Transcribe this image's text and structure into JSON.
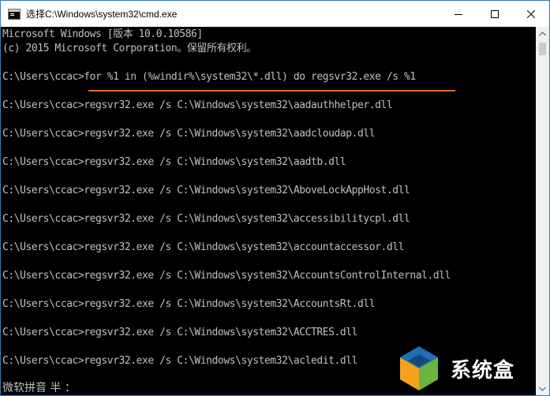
{
  "window": {
    "title": "选择C:\\Windows\\system32\\cmd.exe",
    "controls": {
      "minimize": "minimize-icon",
      "maximize": "maximize-icon",
      "close": "close-icon"
    }
  },
  "console": {
    "header_1": "Microsoft Windows [版本 10.0.10586]",
    "header_2": "(c) 2015 Microsoft Corporation。保留所有权利。",
    "prompt": "C:\\Users\\ccac>",
    "command": "for %1 in (%windir%\\system32\\*.dll) do regsvr32.exe /s %1",
    "output_lines": [
      "C:\\Users\\ccac>regsvr32.exe /s C:\\Windows\\system32\\aadauthhelper.dll",
      "C:\\Users\\ccac>regsvr32.exe /s C:\\Windows\\system32\\aadcloudap.dll",
      "C:\\Users\\ccac>regsvr32.exe /s C:\\Windows\\system32\\aadtb.dll",
      "C:\\Users\\ccac>regsvr32.exe /s C:\\Windows\\system32\\AboveLockAppHost.dll",
      "C:\\Users\\ccac>regsvr32.exe /s C:\\Windows\\system32\\accessibilitycpl.dll",
      "C:\\Users\\ccac>regsvr32.exe /s C:\\Windows\\system32\\accountaccessor.dll",
      "C:\\Users\\ccac>regsvr32.exe /s C:\\Windows\\system32\\AccountsControlInternal.dll",
      "C:\\Users\\ccac>regsvr32.exe /s C:\\Windows\\system32\\AccountsRt.dll",
      "C:\\Users\\ccac>regsvr32.exe /s C:\\Windows\\system32\\ACCTRES.dll",
      "C:\\Users\\ccac>regsvr32.exe /s C:\\Windows\\system32\\acledit.dll"
    ],
    "ime_status": "微软拼音 半 ："
  },
  "watermark": {
    "text": "系统盒",
    "colors": [
      "#1e6fb8",
      "#f7a11a",
      "#6db33f"
    ]
  }
}
